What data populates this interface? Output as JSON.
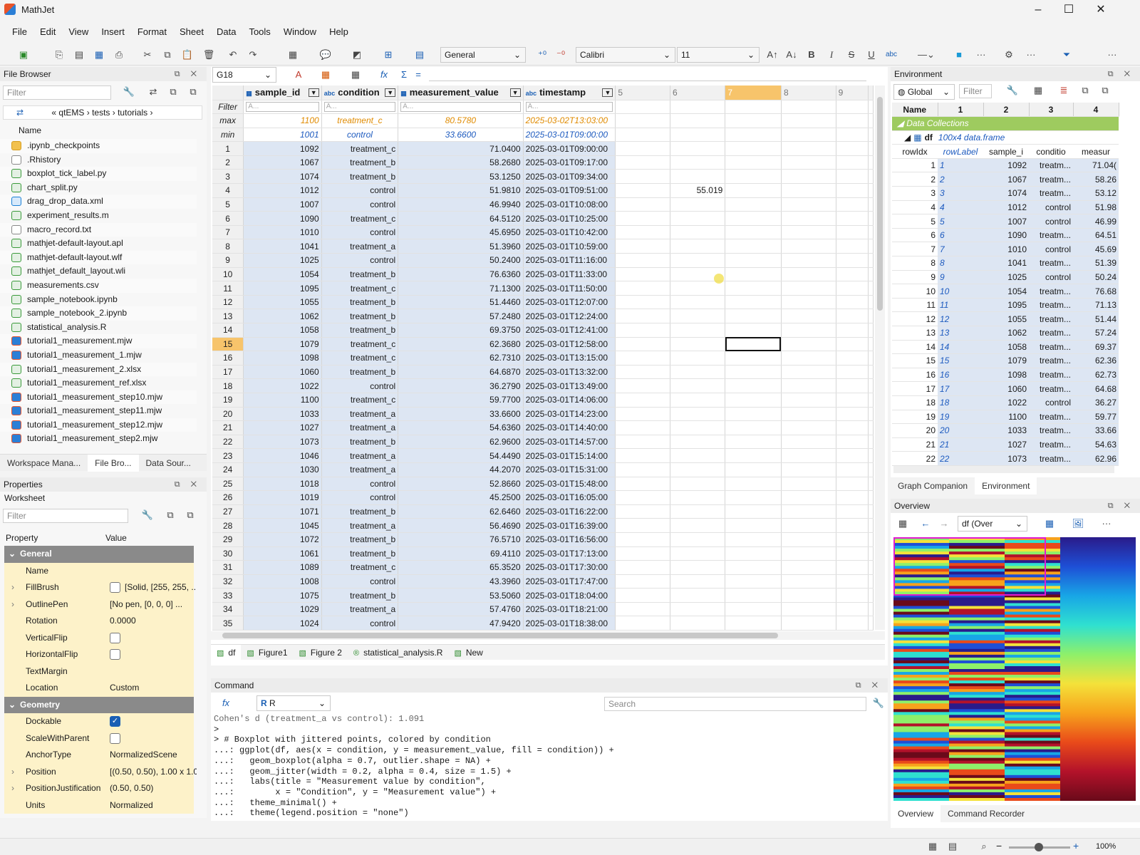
{
  "app": {
    "title": "MathJet"
  },
  "menu": [
    "File",
    "Edit",
    "View",
    "Insert",
    "Format",
    "Sheet",
    "Data",
    "Tools",
    "Window",
    "Help"
  ],
  "toolbar": {
    "format": "General",
    "font": "Calibri",
    "size": "11"
  },
  "file_browser": {
    "title": "File Browser",
    "filter": "Filter",
    "path": "« qtEMS › tests › tutorials ›",
    "col": "Name",
    "items": [
      ".ipynb_checkpoints",
      ".Rhistory",
      "boxplot_tick_label.py",
      "chart_split.py",
      "drag_drop_data.xml",
      "experiment_results.m",
      "macro_record.txt",
      "mathjet-default-layout.apl",
      "mathjet-default-layout.wlf",
      "mathjet_default_layout.wli",
      "measurements.csv",
      "sample_notebook.ipynb",
      "sample_notebook_2.ipynb",
      "statistical_analysis.R",
      "tutorial1_measurement.mjw",
      "tutorial1_measurement_1.mjw",
      "tutorial1_measurement_2.xlsx",
      "tutorial1_measurement_ref.xlsx",
      "tutorial1_measurement_step10.mjw",
      "tutorial1_measurement_step11.mjw",
      "tutorial1_measurement_step12.mjw",
      "tutorial1_measurement_step2.mjw"
    ],
    "tabs": [
      "Workspace Mana...",
      "File Bro...",
      "Data Sour..."
    ]
  },
  "properties": {
    "title": "Properties",
    "tab": "Worksheet",
    "filter": "Filter",
    "col_property": "Property",
    "col_value": "Value",
    "rows": [
      {
        "k": "General",
        "v": "",
        "sec": true
      },
      {
        "k": "Name",
        "v": ""
      },
      {
        "k": "FillBrush",
        "v": "[Solid, [255, 255, ...",
        "exp": true
      },
      {
        "k": "OutlinePen",
        "v": "[No pen, [0, 0, 0] ...",
        "exp": true
      },
      {
        "k": "Rotation",
        "v": "0.0000"
      },
      {
        "k": "VerticalFlip",
        "v": "",
        "cb": "off"
      },
      {
        "k": "HorizontalFlip",
        "v": "",
        "cb": "off"
      },
      {
        "k": "TextMargin",
        "v": ""
      },
      {
        "k": "Location",
        "v": "Custom"
      },
      {
        "k": "Geometry",
        "v": "",
        "sec": true
      },
      {
        "k": "Dockable",
        "v": "",
        "cb": "on"
      },
      {
        "k": "ScaleWithParent",
        "v": "",
        "cb": "off"
      },
      {
        "k": "AnchorType",
        "v": "NormalizedScene"
      },
      {
        "k": "Position",
        "v": "[(0.50, 0.50), 1.00 x 1.00]",
        "exp": true
      },
      {
        "k": "PositionJustification",
        "v": "(0.50, 0.50)",
        "exp": true
      },
      {
        "k": "Units",
        "v": "Normalized"
      }
    ]
  },
  "sheet": {
    "cellref": "G18",
    "headers": [
      "sample_id",
      "condition",
      "measurement_value",
      "timestamp",
      "5",
      "6",
      "7",
      "8",
      "9"
    ],
    "filter_label": "Filter",
    "filter_ph": "A...",
    "max": {
      "label": "max",
      "sample_id": "1100",
      "condition": "treatment_c",
      "measurement_value": "80.5780",
      "timestamp": "2025-03-02T13:03:00"
    },
    "min": {
      "label": "min",
      "sample_id": "1001",
      "condition": "control",
      "measurement_value": "33.6600",
      "timestamp": "2025-03-01T09:00:00"
    },
    "extra_cell": {
      "row": 4,
      "value": "55.019"
    },
    "rows": [
      [
        "1092",
        "treatment_c",
        "71.0400",
        "2025-03-01T09:00:00"
      ],
      [
        "1067",
        "treatment_b",
        "58.2680",
        "2025-03-01T09:17:00"
      ],
      [
        "1074",
        "treatment_b",
        "53.1250",
        "2025-03-01T09:34:00"
      ],
      [
        "1012",
        "control",
        "51.9810",
        "2025-03-01T09:51:00"
      ],
      [
        "1007",
        "control",
        "46.9940",
        "2025-03-01T10:08:00"
      ],
      [
        "1090",
        "treatment_c",
        "64.5120",
        "2025-03-01T10:25:00"
      ],
      [
        "1010",
        "control",
        "45.6950",
        "2025-03-01T10:42:00"
      ],
      [
        "1041",
        "treatment_a",
        "51.3960",
        "2025-03-01T10:59:00"
      ],
      [
        "1025",
        "control",
        "50.2400",
        "2025-03-01T11:16:00"
      ],
      [
        "1054",
        "treatment_b",
        "76.6360",
        "2025-03-01T11:33:00"
      ],
      [
        "1095",
        "treatment_c",
        "71.1300",
        "2025-03-01T11:50:00"
      ],
      [
        "1055",
        "treatment_b",
        "51.4460",
        "2025-03-01T12:07:00"
      ],
      [
        "1062",
        "treatment_b",
        "57.2480",
        "2025-03-01T12:24:00"
      ],
      [
        "1058",
        "treatment_b",
        "69.3750",
        "2025-03-01T12:41:00"
      ],
      [
        "1079",
        "treatment_c",
        "62.3680",
        "2025-03-01T12:58:00"
      ],
      [
        "1098",
        "treatment_c",
        "62.7310",
        "2025-03-01T13:15:00"
      ],
      [
        "1060",
        "treatment_b",
        "64.6870",
        "2025-03-01T13:32:00"
      ],
      [
        "1022",
        "control",
        "36.2790",
        "2025-03-01T13:49:00"
      ],
      [
        "1100",
        "treatment_c",
        "59.7700",
        "2025-03-01T14:06:00"
      ],
      [
        "1033",
        "treatment_a",
        "33.6600",
        "2025-03-01T14:23:00"
      ],
      [
        "1027",
        "treatment_a",
        "54.6360",
        "2025-03-01T14:40:00"
      ],
      [
        "1073",
        "treatment_b",
        "62.9600",
        "2025-03-01T14:57:00"
      ],
      [
        "1046",
        "treatment_a",
        "54.4490",
        "2025-03-01T15:14:00"
      ],
      [
        "1030",
        "treatment_a",
        "44.2070",
        "2025-03-01T15:31:00"
      ],
      [
        "1018",
        "control",
        "52.8660",
        "2025-03-01T15:48:00"
      ],
      [
        "1019",
        "control",
        "45.2500",
        "2025-03-01T16:05:00"
      ],
      [
        "1071",
        "treatment_b",
        "62.6460",
        "2025-03-01T16:22:00"
      ],
      [
        "1045",
        "treatment_a",
        "56.4690",
        "2025-03-01T16:39:00"
      ],
      [
        "1072",
        "treatment_b",
        "76.5710",
        "2025-03-01T16:56:00"
      ],
      [
        "1061",
        "treatment_b",
        "69.4110",
        "2025-03-01T17:13:00"
      ],
      [
        "1089",
        "treatment_c",
        "65.3520",
        "2025-03-01T17:30:00"
      ],
      [
        "1008",
        "control",
        "43.3960",
        "2025-03-01T17:47:00"
      ],
      [
        "1075",
        "treatment_b",
        "53.5060",
        "2025-03-01T18:04:00"
      ],
      [
        "1029",
        "treatment_a",
        "57.4760",
        "2025-03-01T18:21:00"
      ],
      [
        "1024",
        "control",
        "47.9420",
        "2025-03-01T18:38:00"
      ]
    ],
    "tabs": [
      "df",
      "Figure1",
      "Figure 2",
      "statistical_analysis.R",
      "New"
    ]
  },
  "command": {
    "title": "Command",
    "lang": "R",
    "search": "Search",
    "lines": [
      "Cohen's d (treatment_a vs control): 1.091",
      ">",
      "> # Boxplot with jittered points, colored by condition",
      "...: ggplot(df, aes(x = condition, y = measurement_value, fill = condition)) +",
      "...:   geom_boxplot(alpha = 0.7, outlier.shape = NA) +",
      "...:   geom_jitter(width = 0.2, alpha = 0.4, size = 1.5) +",
      "...:   labs(title = \"Measurement value by condition\",",
      "...:        x = \"Condition\", y = \"Measurement value\") +",
      "...:   theme_minimal() +",
      "...:   theme(legend.position = \"none\")",
      ">"
    ]
  },
  "environment": {
    "title": "Environment",
    "scope": "Global",
    "filter": "Filter",
    "cols": [
      "Name",
      "1",
      "2",
      "3",
      "4"
    ],
    "group": "Data Collections",
    "df_name": "df",
    "df_desc": "100x4 data.frame",
    "sub_cols": [
      "rowIdx",
      "rowLabel",
      "sample_i",
      "conditio",
      "measur"
    ],
    "rows": [
      [
        "1",
        "1",
        "1092",
        "treatm...",
        "71.04("
      ],
      [
        "2",
        "2",
        "1067",
        "treatm...",
        "58.26"
      ],
      [
        "3",
        "3",
        "1074",
        "treatm...",
        "53.12"
      ],
      [
        "4",
        "4",
        "1012",
        "control",
        "51.98"
      ],
      [
        "5",
        "5",
        "1007",
        "control",
        "46.99"
      ],
      [
        "6",
        "6",
        "1090",
        "treatm...",
        "64.51"
      ],
      [
        "7",
        "7",
        "1010",
        "control",
        "45.69"
      ],
      [
        "8",
        "8",
        "1041",
        "treatm...",
        "51.39"
      ],
      [
        "9",
        "9",
        "1025",
        "control",
        "50.24"
      ],
      [
        "10",
        "10",
        "1054",
        "treatm...",
        "76.68"
      ],
      [
        "11",
        "11",
        "1095",
        "treatm...",
        "71.13"
      ],
      [
        "12",
        "12",
        "1055",
        "treatm...",
        "51.44"
      ],
      [
        "13",
        "13",
        "1062",
        "treatm...",
        "57.24"
      ],
      [
        "14",
        "14",
        "1058",
        "treatm...",
        "69.37"
      ],
      [
        "15",
        "15",
        "1079",
        "treatm...",
        "62.36"
      ],
      [
        "16",
        "16",
        "1098",
        "treatm...",
        "62.73"
      ],
      [
        "17",
        "17",
        "1060",
        "treatm...",
        "64.68"
      ],
      [
        "18",
        "18",
        "1022",
        "control",
        "36.27"
      ],
      [
        "19",
        "19",
        "1100",
        "treatm...",
        "59.77"
      ],
      [
        "20",
        "20",
        "1033",
        "treatm...",
        "33.66"
      ],
      [
        "21",
        "21",
        "1027",
        "treatm...",
        "54.63"
      ],
      [
        "22",
        "22",
        "1073",
        "treatm...",
        "62.96"
      ]
    ],
    "tabs": [
      "Graph Companion",
      "Environment"
    ]
  },
  "overview": {
    "title": "Overview",
    "combo": "df (Over",
    "tabs": [
      "Overview",
      "Command Recorder"
    ],
    "zoom": "100%"
  }
}
